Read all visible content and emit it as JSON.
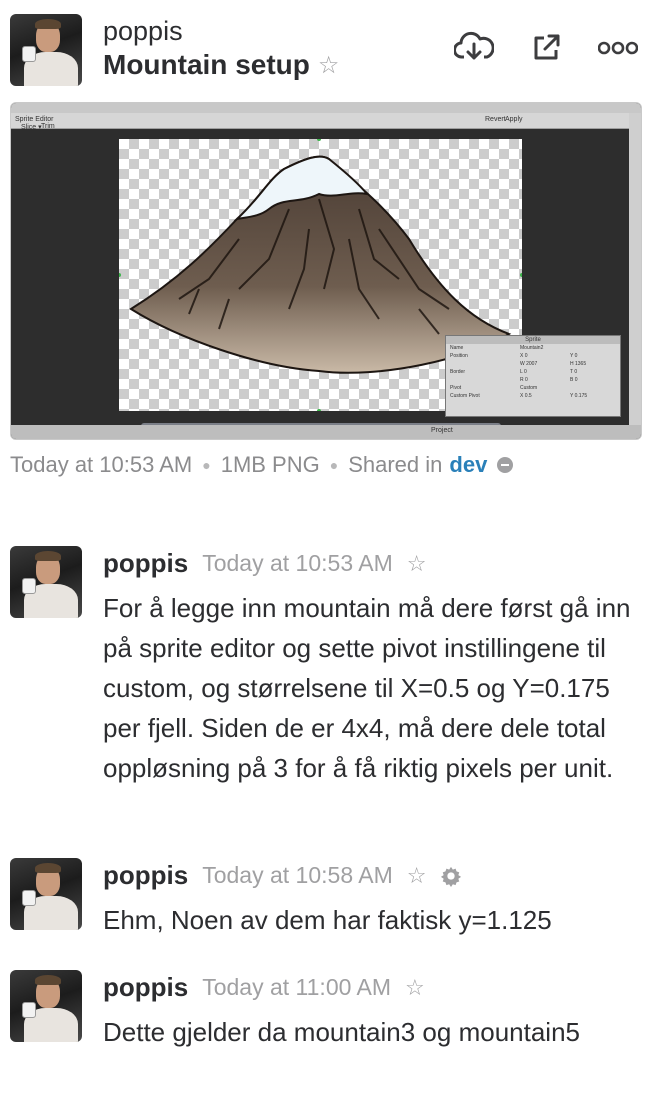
{
  "header": {
    "username": "poppis",
    "file_title": "Mountain setup"
  },
  "actions": {
    "icons": [
      "download-icon",
      "open-external-icon",
      "more-options-icon"
    ]
  },
  "preview": {
    "window_title": "Sprite Editor",
    "toolbar": [
      "Slice ▾",
      "Trim",
      "Revert",
      "Apply"
    ],
    "bottom_tab": "Project",
    "sprite_panel": {
      "title": "Sprite",
      "name_label": "Name",
      "name_value": "Mountain2",
      "position_label": "Position",
      "x": "X 0",
      "y": "Y 0",
      "w": "W 2007",
      "h": "H 1365",
      "border_label": "Border",
      "l": "L 0",
      "t": "T 0",
      "r": "R 0",
      "b": "B 0",
      "pivot_label": "Pivot",
      "pivot_value": "Custom",
      "custom_pivot_label": "Custom Pivot",
      "cx": "X 0.5",
      "cy": "Y 0.175"
    }
  },
  "file_meta": {
    "time": "Today at 10:53 AM",
    "size": "1MB PNG",
    "shared_label": "Shared in",
    "channel": "dev"
  },
  "messages": [
    {
      "user": "poppis",
      "time": "Today at 10:53 AM",
      "text": "For å legge inn mountain må dere først gå inn på sprite editor og sette pivot instillingene til custom, og størrelsene til X=0.5 og Y=0.175 per fjell. Siden de er 4x4, må dere dele total oppløsning på 3 for å få riktig pixels per unit."
    },
    {
      "user": "poppis",
      "time": "Today at 10:58 AM",
      "text": "Ehm, Noen av dem har faktisk y=1.125"
    },
    {
      "user": "poppis",
      "time": "Today at 11:00 AM",
      "text": "Dette gjelder da mountain3 og mountain5"
    }
  ],
  "colors": {
    "text": "#2c2d30",
    "muted": "#8b8b8d",
    "link": "#2a80b9"
  }
}
